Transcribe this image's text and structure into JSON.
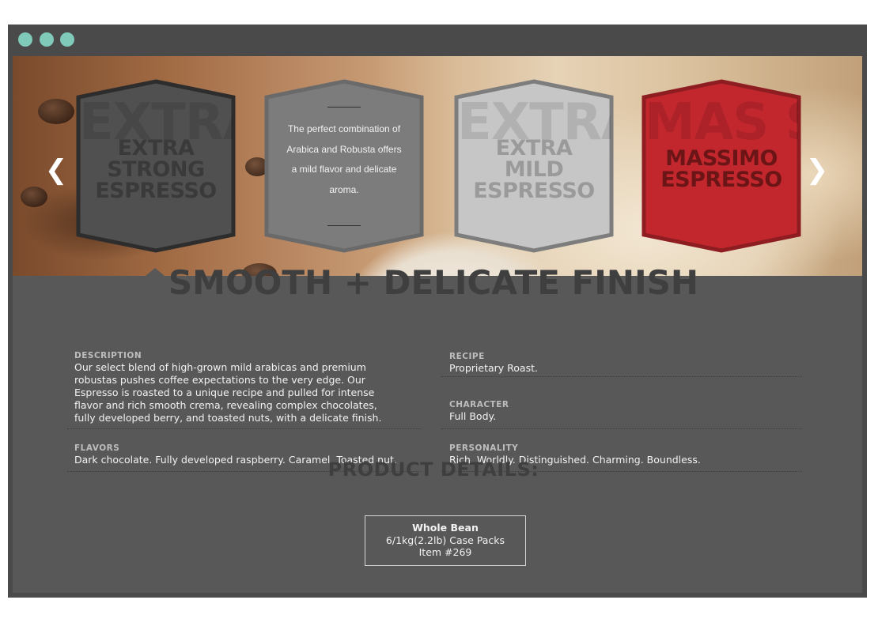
{
  "window": {
    "dot_color": "#7fcab9",
    "chrome_color": "#4a4a4a"
  },
  "carousel": {
    "prev_arrow": "❮",
    "next_arrow": "❯",
    "badges": [
      {
        "label_lines": [
          "EXTRA",
          "STRONG",
          "ESPRESSO"
        ],
        "bg_text": "EXTRA STRO",
        "fill": "#505050",
        "stroke": "#2d2d2d",
        "text_color": "#3a3a3a"
      },
      {
        "description": "The perfect combination of Arabica and Robusta offers a mild flavor and delicate aroma.",
        "fill": "#7c7c7c",
        "stroke": "#6a6a6a"
      },
      {
        "label_lines": [
          "EXTRA",
          "MILD",
          "ESPRESSO"
        ],
        "bg_text": "EXTRA MILD",
        "fill": "#c6c6c6",
        "stroke": "#7d7d7d",
        "text_color": "#9a9a9a"
      },
      {
        "label_lines": [
          "MASSIMO",
          "ESPRESSO"
        ],
        "bg_text": "MAS SIMO",
        "fill": "#c1272d",
        "stroke": "#8e1d21",
        "text_color": "#6b1517"
      }
    ]
  },
  "details": {
    "heading": "SMOOTH + DELICATE FINISH",
    "description": {
      "label": "DESCRIPTION",
      "lines": [
        "Our select blend of high-grown mild arabicas and premium",
        "robustas pushes coffee expectations to the very edge. Our",
        "Espresso is roasted to a unique recipe and pulled for intense",
        "flavor and rich smooth crema, revealing complex chocolates,",
        "fully developed berry, and toasted nuts, with a delicate finish."
      ]
    },
    "flavors": {
      "label": "FLAVORS",
      "value": "Dark chocolate. Fully developed raspberry. Caramel. Toasted nut."
    },
    "recipe": {
      "label": "RECIPE",
      "value": "Proprietary Roast."
    },
    "character": {
      "label": "CHARACTER",
      "value": "Full Body."
    },
    "personality": {
      "label": "PERSONALITY",
      "value": "Rich. Worldly. Distinguished. Charming. Boundless."
    }
  },
  "product_details": {
    "title": "PRODUCT DETAILS:",
    "name": "Whole Bean",
    "packs": "6/1kg(2.2lb) Case Packs",
    "item": "Item #269"
  }
}
